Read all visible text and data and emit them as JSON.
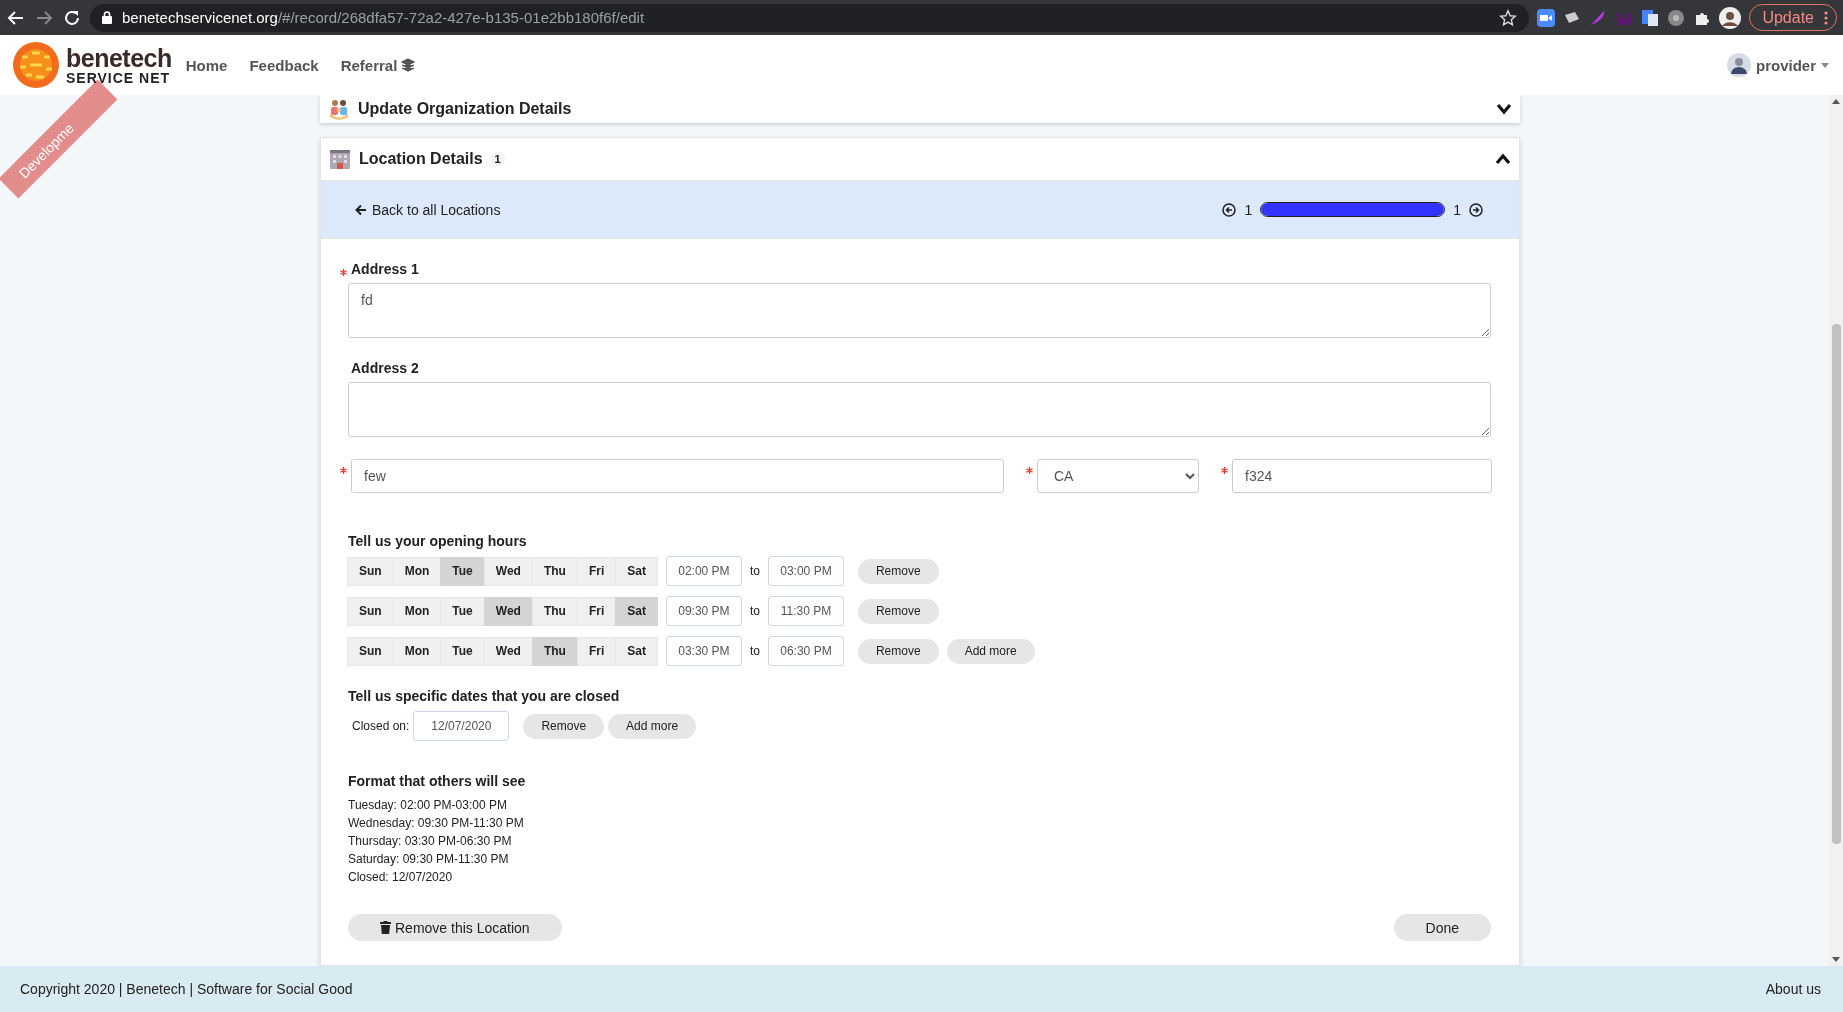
{
  "browser": {
    "url_host": "benetechservicenet.org",
    "url_path": "/#/record/268dfa57-72a2-427e-b135-01e2bb180f6f/edit",
    "update_label": "Update"
  },
  "navbar": {
    "logo_top": "benetech",
    "logo_bottom": "SERVICE NET",
    "ribbon": "Developme",
    "links": [
      "Home",
      "Feedback",
      "Referral"
    ],
    "user": "provider"
  },
  "org_panel": {
    "title": "Update Organization Details",
    "expanded": false
  },
  "location_panel": {
    "title": "Location Details",
    "count": "1",
    "expanded": true,
    "back": "Back to all Locations",
    "pager": {
      "current": "1",
      "total": "1",
      "level": 1
    },
    "address1": {
      "label": "Address 1",
      "value": "fd",
      "required": true
    },
    "address2": {
      "label": "Address 2",
      "required": false
    },
    "city": {
      "value": "few",
      "required": true
    },
    "state": {
      "value": "CA",
      "required": true
    },
    "zip": {
      "value": "f324",
      "required": true
    },
    "hours": {
      "title": "Tell us your opening hours",
      "rows": [
        {
          "days": [
            {
              "label": "Sun",
              "selected": false
            },
            {
              "label": "Mon",
              "selected": false
            },
            {
              "label": "Tue",
              "selected": true
            },
            {
              "label": "Wed",
              "selected": false
            },
            {
              "label": "Thu",
              "selected": false
            },
            {
              "label": "Fri",
              "selected": false
            },
            {
              "label": "Sat",
              "selected": false
            }
          ],
          "from": "02:00 PM",
          "to_label": "to",
          "to": "03:00 PM",
          "remove": "Remove"
        },
        {
          "days": [
            {
              "label": "Sun",
              "selected": false
            },
            {
              "label": "Mon",
              "selected": false
            },
            {
              "label": "Tue",
              "selected": false
            },
            {
              "label": "Wed",
              "selected": true
            },
            {
              "label": "Thu",
              "selected": false
            },
            {
              "label": "Fri",
              "selected": false
            },
            {
              "label": "Sat",
              "selected": true
            }
          ],
          "from": "09:30 PM",
          "to_label": "to",
          "to": "11:30 PM",
          "remove": "Remove"
        },
        {
          "days": [
            {
              "label": "Sun",
              "selected": false
            },
            {
              "label": "Mon",
              "selected": false
            },
            {
              "label": "Tue",
              "selected": false
            },
            {
              "label": "Wed",
              "selected": false
            },
            {
              "label": "Thu",
              "selected": true
            },
            {
              "label": "Fri",
              "selected": false
            },
            {
              "label": "Sat",
              "selected": false
            }
          ],
          "from": "03:30 PM",
          "to_label": "to",
          "to": "06:30 PM",
          "remove": "Remove",
          "add_more": "Add more"
        }
      ]
    },
    "closed": {
      "title": "Tell us specific dates that you are closed",
      "label": "Closed on:",
      "value": "12/07/2020",
      "remove": "Remove",
      "add_more": "Add more"
    },
    "format": {
      "title": "Format that others will see",
      "lines": [
        "Tuesday: 02:00 PM-03:00 PM",
        "Wednesday: 09:30 PM-11:30 PM",
        "Thursday: 03:30 PM-06:30 PM",
        "Saturday: 09:30 PM-11:30 PM",
        "Closed: 12/07/2020"
      ]
    },
    "remove_location": "Remove this Location",
    "done": "Done"
  },
  "footer": {
    "copyright": "Copyright 2020 | Benetech | Software for Social Good",
    "about": "About us"
  }
}
